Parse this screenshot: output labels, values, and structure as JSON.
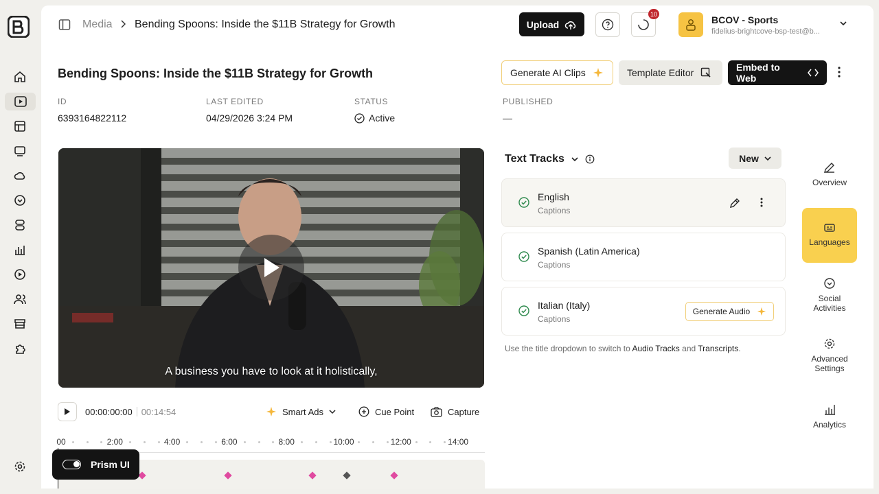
{
  "breadcrumb": {
    "root": "Media",
    "current": "Bending Spoons: Inside the $11B Strategy for Growth"
  },
  "header": {
    "upload_label": "Upload",
    "notification_count": "10",
    "account_name": "BCOV - Sports",
    "account_email": "fidelius-brightcove-bsp-test@b..."
  },
  "video": {
    "title": "Bending Spoons: Inside the $11B Strategy for Growth",
    "actions": {
      "ai_clips": "Generate AI Clips",
      "template_editor": "Template Editor",
      "embed": "Embed to Web"
    },
    "meta": [
      {
        "label": "ID",
        "value": "6393164822112"
      },
      {
        "label": "LAST EDITED",
        "value": "04/29/2026 3:24 PM"
      },
      {
        "label": "STATUS",
        "value": "Active"
      },
      {
        "label": "PUBLISHED",
        "value": "—"
      }
    ],
    "caption": "A business you have to look at it holistically,"
  },
  "controls": {
    "current_time": "00:00:00:00",
    "total_time": "00:14:54",
    "smart_ads": "Smart Ads",
    "cue_point": "Cue Point",
    "capture": "Capture"
  },
  "timeline": {
    "ticks": [
      "00",
      "2:00",
      "4:00",
      "6:00",
      "8:00",
      "10:00",
      "12:00",
      "14:00"
    ],
    "marker_positions": [
      0.198,
      0.398,
      0.597,
      0.677,
      0.787
    ],
    "marker_colors": [
      "#e04aa0",
      "#e04aa0",
      "#e04aa0",
      "#555555",
      "#e04aa0"
    ]
  },
  "text_tracks": {
    "title": "Text Tracks",
    "new_label": "New",
    "items": [
      {
        "language": "English",
        "kind": "Captions"
      },
      {
        "language": "Spanish (Latin America)",
        "kind": "Captions"
      },
      {
        "language": "Italian (Italy)",
        "kind": "Captions",
        "action": "Generate Audio"
      }
    ],
    "hint_prefix": "Use the title dropdown to switch to ",
    "hint_audio": "Audio Tracks",
    "hint_and": " and ",
    "hint_transcripts": "Transcripts",
    "hint_suffix": "."
  },
  "right_nav": {
    "overview": "Overview",
    "languages": "Languages",
    "social1": "Social",
    "social2": "Activities",
    "advanced1": "Advanced",
    "advanced2": "Settings",
    "analytics": "Analytics"
  },
  "prism": {
    "label": "Prism UI"
  },
  "colors": {
    "accent_yellow": "#f9d04f",
    "dark": "#141414",
    "check_green": "#2f8a4e"
  }
}
